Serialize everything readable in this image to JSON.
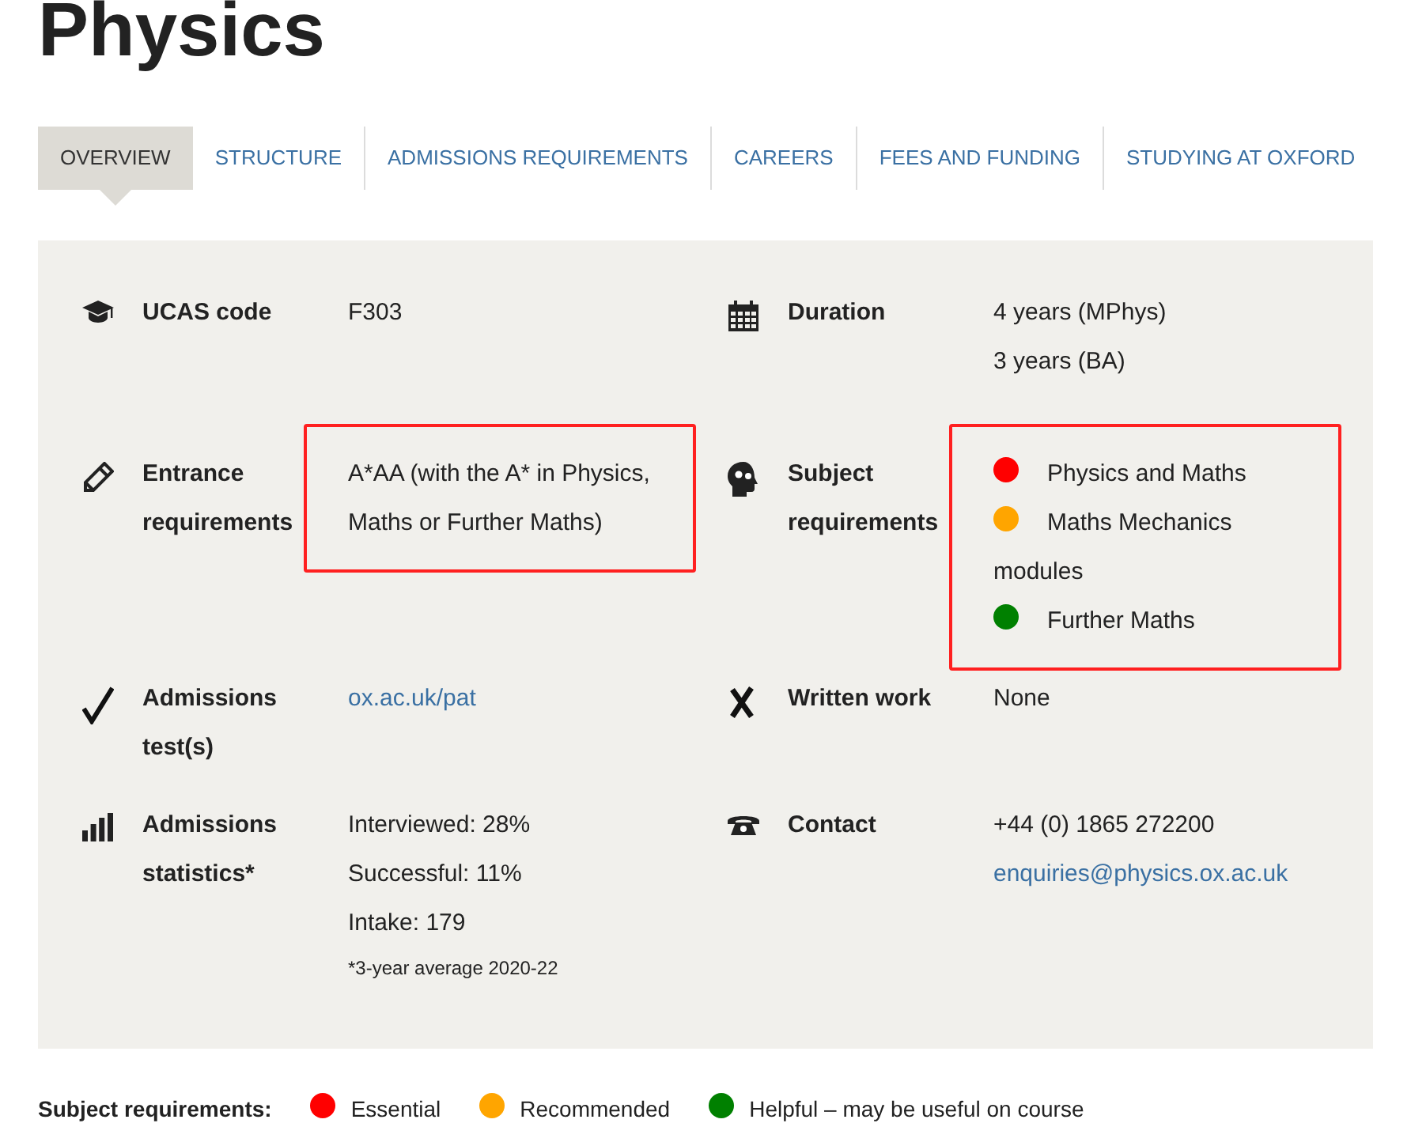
{
  "title": "Physics",
  "tabs": [
    {
      "label": "OVERVIEW",
      "selected": true
    },
    {
      "label": "STRUCTURE",
      "selected": false
    },
    {
      "label": "ADMISSIONS REQUIREMENTS",
      "selected": false
    },
    {
      "label": "CAREERS",
      "selected": false
    },
    {
      "label": "FEES AND FUNDING",
      "selected": false
    },
    {
      "label": "STUDYING AT OXFORD",
      "selected": false
    }
  ],
  "facts": [
    {
      "label": "UCAS code",
      "highlighted": false,
      "lines": [
        {
          "kind": "text",
          "text": "F303"
        }
      ]
    },
    {
      "label": "Duration",
      "highlighted": false,
      "lines": [
        {
          "kind": "text",
          "text": "4 years (MPhys)"
        },
        {
          "kind": "text",
          "text": "3 years (BA)"
        }
      ]
    },
    {
      "label": "Entrance requirements",
      "highlighted": true,
      "lines": [
        {
          "kind": "text",
          "text": "A*AA (with the A* in Physics, Maths or Further Maths)"
        }
      ]
    },
    {
      "label": "Subject requirements",
      "highlighted": true,
      "lines": [
        {
          "kind": "dot",
          "color": "#ff0000",
          "text": "Physics and Maths"
        },
        {
          "kind": "dot",
          "color": "#ffa500",
          "text": "Maths Mechanics modules"
        },
        {
          "kind": "dot",
          "color": "#008000",
          "text": "Further Maths"
        }
      ]
    },
    {
      "label": "Admissions test(s)",
      "highlighted": false,
      "lines": [
        {
          "kind": "link",
          "text": "ox.ac.uk/pat"
        }
      ]
    },
    {
      "label": "Written work",
      "highlighted": false,
      "lines": [
        {
          "kind": "text",
          "text": "None"
        }
      ]
    },
    {
      "label": "Admissions statistics*",
      "highlighted": false,
      "lines": [
        {
          "kind": "text",
          "text": "Interviewed: 28%"
        },
        {
          "kind": "text",
          "text": "Successful: 11%"
        },
        {
          "kind": "text",
          "text": "Intake: 179"
        },
        {
          "kind": "note",
          "text": "*3-year average 2020-22"
        }
      ]
    },
    {
      "label": "Contact",
      "highlighted": false,
      "lines": [
        {
          "kind": "text",
          "text": "+44 (0) 1865 272200"
        },
        {
          "kind": "link",
          "text": "enquiries@physics.ox.ac.uk"
        }
      ]
    }
  ],
  "legend": {
    "label": "Subject requirements:",
    "items": [
      {
        "color": "#ff0000",
        "text": "Essential"
      },
      {
        "color": "#ffa500",
        "text": "Recommended"
      },
      {
        "color": "#008000",
        "text": "Helpful – may be useful on course"
      }
    ]
  }
}
